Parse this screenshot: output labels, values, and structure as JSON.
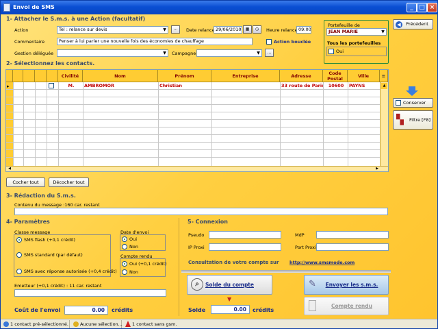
{
  "window": {
    "title": "Envoi de SMS"
  },
  "section1": {
    "title": "1- Attacher le S.m.s. à une Action (facultatif)",
    "action_label": "Action",
    "action_value": "Tel : relance sur devis",
    "date_relance_label": "Date relance",
    "date_relance_value": "29/06/2010",
    "heure_relance_label": "Heure relance",
    "heure_relance_value": "09:00",
    "commentaire_label": "Commentaire",
    "commentaire_value": "Penser à lui parler une nouvelle fois des économies de chauffage",
    "action_bouclee_label": "Action bouclée",
    "gestion_label": "Gestion déléguée",
    "campagne_label": "Campagne",
    "portefeuille_label": "Portefeuille de",
    "portefeuille_value": "JEAN MARIE",
    "tous_portefeuilles_label": "Tous les portefeuilles",
    "oui_label": "Oui"
  },
  "precedent_label": "Précédent",
  "section2": {
    "title": "2- Sélectionnez les contacts.",
    "columns": [
      "Civilité",
      "Nom",
      "Prénom",
      "Entreprise",
      "Adresse",
      "Code Postal",
      "Ville"
    ],
    "rows": [
      {
        "civilite": "M.",
        "nom": "AMBROMOR",
        "prenom": "Christian",
        "entreprise": "",
        "adresse": "33 route de Paris",
        "cp": "10600",
        "ville": "PAYNS"
      }
    ],
    "cocher_tout": "Cocher tout",
    "decocher_tout": "Décocher tout",
    "conserver_label": "Conserver",
    "filtre_label": "Filtre [F8]"
  },
  "section3": {
    "title": "3- Rédaction du S.m.s.",
    "contenu_label": "Contenu du message :160 car. restant",
    "contenu_value": ""
  },
  "section4": {
    "title": "4- Paramètres",
    "classe_label": "Classe message",
    "classe_options": [
      "SMS flash (+0,1 crédit)",
      "SMS standard (par défaut)",
      "SMS avec réponse autorisée (+0,4 crédit)"
    ],
    "date_envoi_label": "Date d'envoi",
    "date_envoi_options": [
      "Oui",
      "Non"
    ],
    "compte_rendu_label": "Compte rendu",
    "compte_rendu_options": [
      "Oui (+0,1 crédit)",
      "Non"
    ],
    "emetteur_label": "Emetteur (+0,1 crédit) : 11 car. restant",
    "cout_label": "Coût de l'envoi",
    "cout_value": "0.00",
    "credits_label": "crédits"
  },
  "section5": {
    "title": "5- Connexion",
    "pseudo_label": "Pseudo",
    "mdp_label": "MdP",
    "ip_proxi_label": "IP Proxi",
    "port_proxi_label": "Port Proxi",
    "consultation_label": "Consultation de votre compte sur",
    "link": "http://www.smsmode.com",
    "solde_button": "Solde du compte",
    "solde_label": "Solde",
    "solde_value": "0.00",
    "credits_label": "crédits",
    "envoyer_button": "Envoyer les s.m.s.",
    "compte_rendu_button": "Compte rendu"
  },
  "statusbar": {
    "part1": "1 contact pré-sélectionné.",
    "part2": "Aucune sélection...",
    "part3": "1 contact sans gsm."
  }
}
